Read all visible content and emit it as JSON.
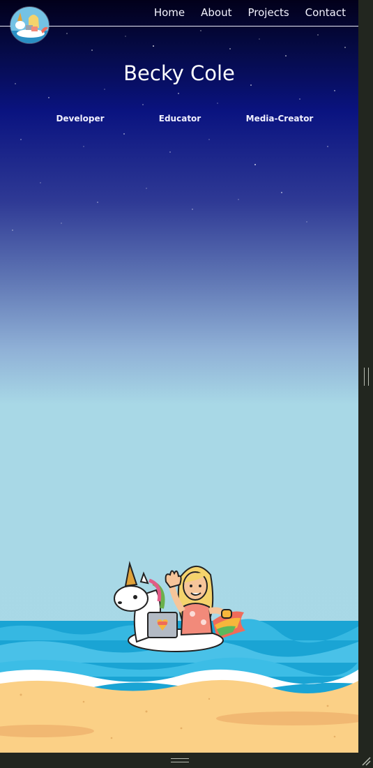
{
  "site": {
    "title": "Becky Cole",
    "roles": [
      "Developer",
      "Educator",
      "Media-Creator"
    ]
  },
  "nav": {
    "items": [
      "Home",
      "About",
      "Projects",
      "Contact"
    ]
  },
  "illustrations": {
    "logo": "unicorn-float-avatar-icon",
    "hero": "girl-on-unicorn-float-with-laptop-at-beach"
  },
  "colors": {
    "sky_top": "#02001a",
    "sky_mid": "#0a1380",
    "sky_bottom": "#a9d9e7",
    "sea": "#1aa4d4",
    "sand": "#fbd086",
    "text": "#ffffff"
  }
}
